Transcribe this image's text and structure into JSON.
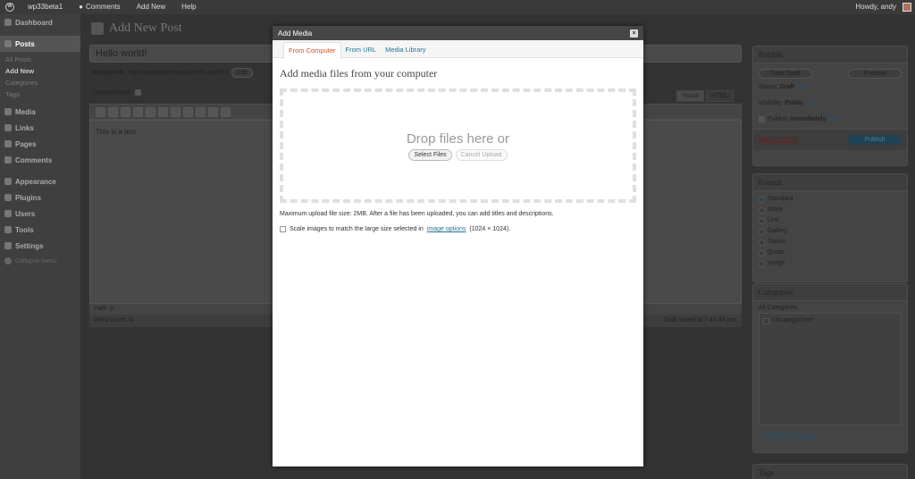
{
  "adminbar": {
    "site_name": "wp33beta1",
    "comments": "Comments",
    "add_new": "Add New",
    "help": "Help",
    "howdy": "Howdy, andy"
  },
  "menu": {
    "dashboard": "Dashboard",
    "posts": "Posts",
    "posts_sub": [
      "All Posts",
      "Add New",
      "Categories",
      "Tags"
    ],
    "items": [
      "Media",
      "Links",
      "Pages",
      "Comments"
    ],
    "items2": [
      "Appearance",
      "Plugins",
      "Users",
      "Tools",
      "Settings"
    ],
    "collapse": "Collapse menu"
  },
  "editor": {
    "page_title": "Add New Post",
    "post_title": "Hello world!",
    "permalink_label": "Permalink:",
    "permalink_base": "http://bumblebee/wp33/",
    "permalink_slug": "hello-world-2",
    "edit_btn": "Edit",
    "upload_insert": "Upload/Insert",
    "tab_visual": "Visual",
    "tab_html": "HTML",
    "content": "This is a test.",
    "path": "Path: p",
    "word_count": "Word count: 0",
    "draft_saved": "Draft saved at 7:41:43 pm."
  },
  "publish_box": {
    "title": "Publish",
    "save_draft": "Save Draft",
    "preview": "Preview",
    "status_label": "Status:",
    "status_value": "Draft",
    "visibility_label": "Visibility:",
    "visibility_value": "Public",
    "publish_label": "Publish",
    "publish_value": "immediately",
    "edit": "Edit",
    "trash": "Move to Trash",
    "publish_btn": "Publish"
  },
  "format_box": {
    "title": "Format",
    "options": [
      "Standard",
      "Aside",
      "Link",
      "Gallery",
      "Status",
      "Quote",
      "Image"
    ]
  },
  "categories_box": {
    "title": "Categories",
    "tab": "All Categories",
    "item": "Uncategorized",
    "add_new": "+ Add New Category"
  },
  "tags_box": {
    "title": "Tags"
  },
  "modal": {
    "title": "Add Media",
    "close": "×",
    "tabs": [
      "From Computer",
      "From URL",
      "Media Library"
    ],
    "heading": "Add media files from your computer",
    "drop_text": "Drop files here or",
    "select_files": "Select Files",
    "cancel_upload": "Cancel Upload",
    "max_size": "Maximum upload file size: 2MB. After a file has been uploaded, you can add titles and descriptions.",
    "scale_text_before": "Scale images to match the large size selected in",
    "scale_link": "image options",
    "scale_text_after": "(1024 × 1024)."
  }
}
